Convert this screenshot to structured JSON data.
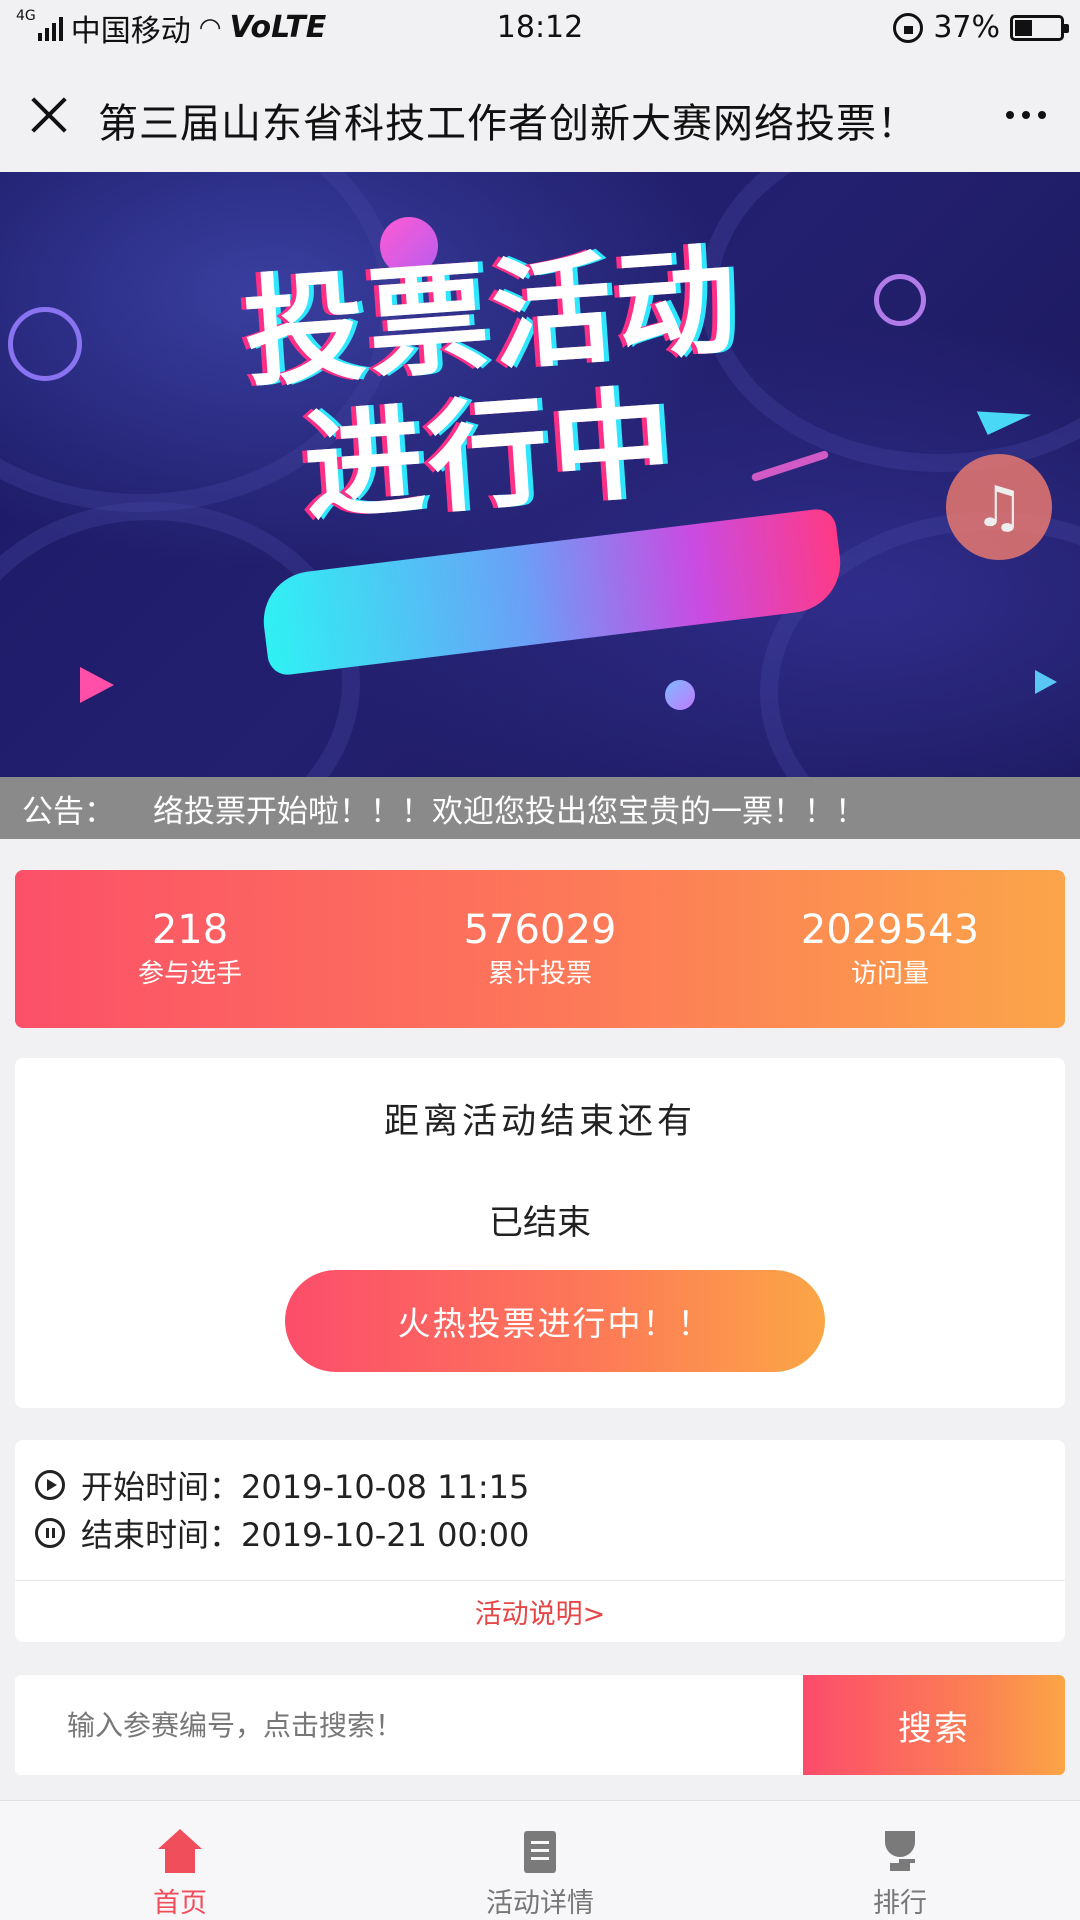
{
  "status_bar": {
    "network_type": "4G",
    "carrier": "中国移动",
    "volte": "VoLTE",
    "time": "18:12",
    "battery": "37%"
  },
  "nav": {
    "title": "第三届山东省科技工作者创新大赛网络投票！"
  },
  "banner": {
    "line1": "投票活动",
    "line2": "进行中",
    "music_icon": "♫"
  },
  "notice": {
    "label": "公告：",
    "text": "络投票开始啦！！！欢迎您投出您宝贵的一票！！！"
  },
  "stats": [
    {
      "value": "218",
      "label": "参与选手"
    },
    {
      "value": "576029",
      "label": "累计投票"
    },
    {
      "value": "2029543",
      "label": "访问量"
    }
  ],
  "countdown": {
    "title": "距离活动结束还有",
    "value": "已结束",
    "button_label": "火热投票进行中！！"
  },
  "schedule": {
    "start": "开始时间：2019-10-08 11:15",
    "end": "结束时间：2019-10-21 00:00",
    "rules_link": "活动说明>"
  },
  "search": {
    "placeholder": "输入参赛编号，点击搜索！",
    "button_label": "搜索"
  },
  "tabs": [
    {
      "label": "首页",
      "icon": "home-icon",
      "active": true
    },
    {
      "label": "活动详情",
      "icon": "document-icon",
      "active": false
    },
    {
      "label": "排行",
      "icon": "trophy-icon",
      "active": false
    }
  ],
  "colors": {
    "accent_start": "#fc4d6b",
    "accent_end": "#fba646",
    "active_tab": "#f14e5b",
    "link": "#e64646"
  }
}
